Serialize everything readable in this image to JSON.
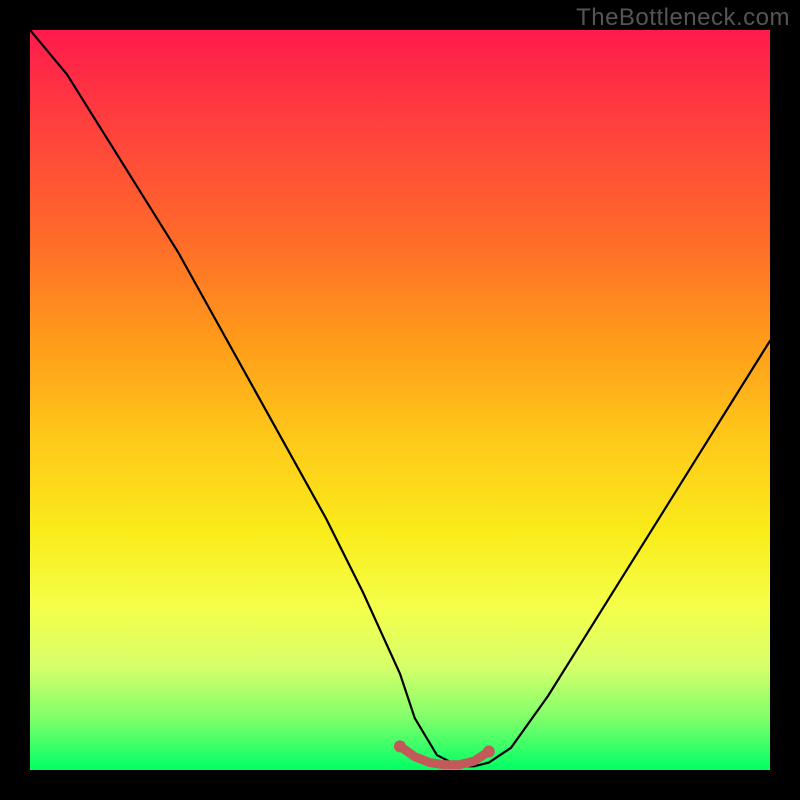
{
  "watermark": "TheBottleneck.com",
  "chart_data": {
    "type": "line",
    "title": "",
    "xlabel": "",
    "ylabel": "",
    "xlim": [
      0,
      100
    ],
    "ylim": [
      0,
      100
    ],
    "series": [
      {
        "name": "bottleneck-curve",
        "x": [
          0,
          5,
          10,
          15,
          20,
          25,
          30,
          35,
          40,
          45,
          50,
          52,
          55,
          58,
          60,
          62,
          65,
          70,
          75,
          80,
          85,
          90,
          95,
          100
        ],
        "y": [
          100,
          94,
          86,
          78,
          70,
          61,
          52,
          43,
          34,
          24,
          13,
          7,
          2,
          0.5,
          0.5,
          1,
          3,
          10,
          18,
          26,
          34,
          42,
          50,
          58
        ]
      },
      {
        "name": "optimal-band",
        "x": [
          50,
          52,
          54,
          56,
          58,
          60,
          62
        ],
        "y": [
          3.2,
          1.8,
          1.0,
          0.7,
          0.7,
          1.2,
          2.5
        ]
      }
    ],
    "colors": {
      "curve": "#000000",
      "band": "#c25a5a",
      "gradient_top": "#ff1a4d",
      "gradient_bottom": "#00ff66"
    }
  }
}
